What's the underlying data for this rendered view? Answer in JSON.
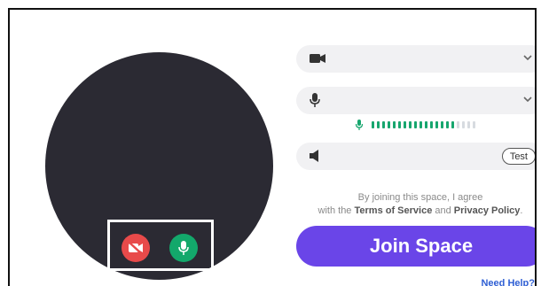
{
  "colors": {
    "preview_bg": "#2b2a33",
    "camera_off_red": "#e84a4a",
    "mic_green": "#13a86b",
    "join_purple": "#6a45e8",
    "help_blue": "#2f5fd4",
    "pill_bg": "#f1f1f3"
  },
  "preview": {
    "camera_button_icon": "video-off-icon",
    "mic_button_icon": "microphone-icon"
  },
  "devices": {
    "camera_icon": "video-camera-icon",
    "mic_icon": "microphone-icon",
    "speaker_icon": "speaker-icon",
    "chevron_icon": "chevron-down-icon"
  },
  "mic_level": {
    "icon": "microphone-icon",
    "active_bars": 16,
    "total_bars": 20
  },
  "speaker": {
    "test_label": "Test"
  },
  "agreement": {
    "line1": "By joining this space, I agree",
    "line2_prefix": "with the ",
    "terms_link": "Terms of Service",
    "and_text": " and ",
    "privacy_link": "Privacy Policy",
    "period": "."
  },
  "join_button_label": "Join Space",
  "help_link": "Need Help?"
}
